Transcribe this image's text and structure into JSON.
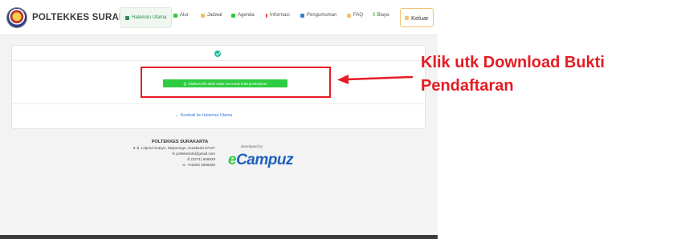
{
  "navbar": {
    "brand": "POLTEKKES SURAKARTA",
    "items": [
      {
        "label": "Halaman Utama",
        "icon": "home-icon",
        "color": "#2e8b57"
      },
      {
        "label": "Alur",
        "icon": "check-icon",
        "color": "#2ecc40"
      },
      {
        "label": "Jadwal",
        "icon": "calendar-icon",
        "color": "#f0c36d"
      },
      {
        "label": "Agenda",
        "icon": "agenda-icon",
        "color": "#2ecc40"
      },
      {
        "label": "Informasi",
        "icon": "info-icon",
        "color": "#e74c3c"
      },
      {
        "label": "Pengumuman",
        "icon": "megaphone-icon",
        "color": "#3a7bd5"
      },
      {
        "label": "FAQ",
        "icon": "faq-icon",
        "color": "#f0c36d"
      },
      {
        "label": "Biaya",
        "icon": "dollar-icon",
        "color": "#2ecc40"
      }
    ],
    "logout": "Keluar"
  },
  "main": {
    "download_button": "Silahkan klik disini untuk mencetak bukti pendaftaran",
    "back_link": "Kembali ke Halaman Utama"
  },
  "footer": {
    "institution": "POLTEKKES SURAKARTA",
    "address": "Jl. Letjend Sutoyo, Mojosongo, Surakarta 57127",
    "email": "poltekssolo@gmail.com",
    "phone": "(0271) 856929",
    "whatsapp": "+62853 2656929",
    "developed_by": "developed by",
    "developer": "Campuz",
    "developer_prefix": "e"
  },
  "annotation": {
    "callout": "Klik utk Download Bukti Pendaftaran",
    "color": "#e51c23"
  }
}
